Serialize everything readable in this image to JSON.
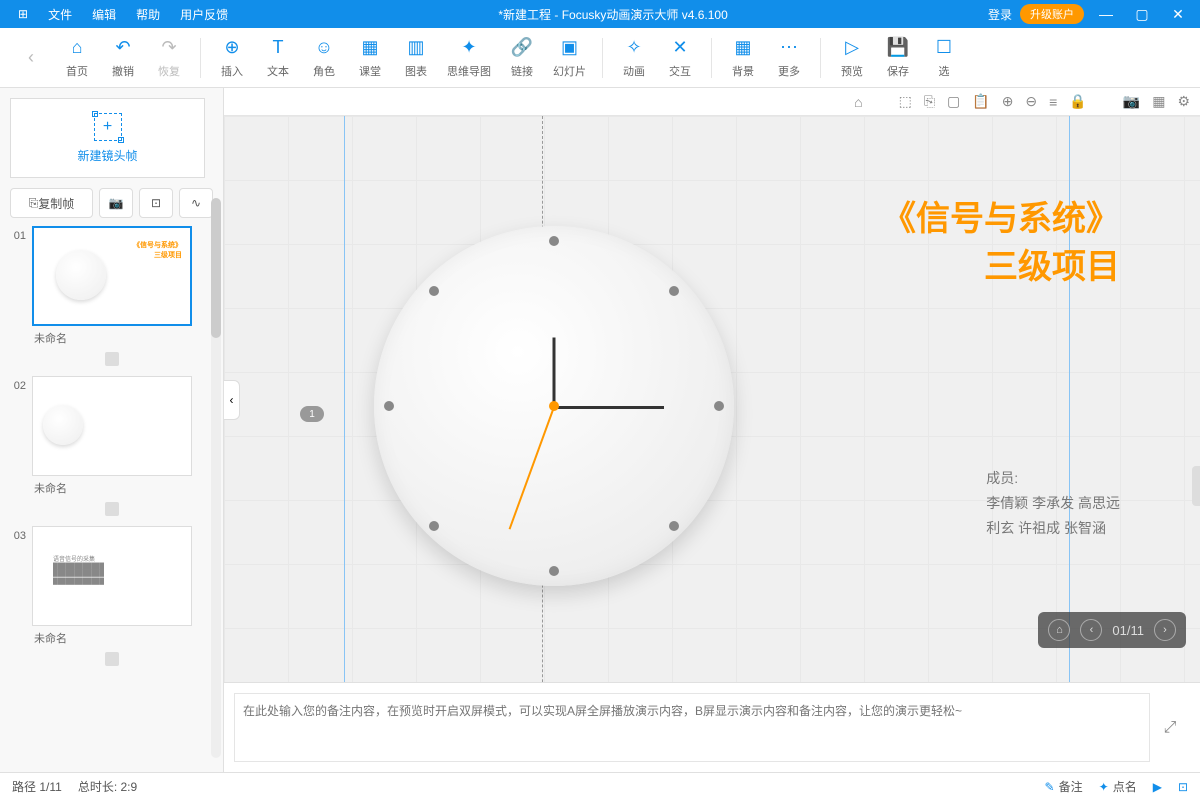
{
  "titlebar": {
    "title": "*新建工程 - Focusky动画演示大师  v4.6.100",
    "login": "登录",
    "upgrade": "升级账户",
    "menus": [
      "文件",
      "编辑",
      "帮助",
      "用户反馈"
    ]
  },
  "toolbar": {
    "home": "首页",
    "undo": "撤销",
    "redo": "恢复",
    "insert": "插入",
    "text": "文本",
    "role": "角色",
    "class": "课堂",
    "chart": "图表",
    "mind": "思维导图",
    "link": "链接",
    "slide": "幻灯片",
    "anim": "动画",
    "interact": "交互",
    "bg": "背景",
    "more": "更多",
    "preview": "预览",
    "save": "保存",
    "select": "选"
  },
  "sidebar": {
    "newframe": "新建镜头帧",
    "copy": "复制帧",
    "thumbs": [
      {
        "num": "01",
        "label": "未命名"
      },
      {
        "num": "02",
        "label": "未命名"
      },
      {
        "num": "03",
        "label": "未命名"
      }
    ]
  },
  "canvas": {
    "title1": "《信号与系统》",
    "title2": "三级项目",
    "members_label": "成员:",
    "members_l1": "李倩颖  李承发   高思远",
    "members_l2": "利玄     许祖成   张智涵",
    "marker": "1",
    "nav": "01/11"
  },
  "notes": {
    "placeholder": "在此处输入您的备注内容，在预览时开启双屏模式，可以实现A屏全屏播放演示内容，B屏显示演示内容和备注内容，让您的演示更轻松~"
  },
  "status": {
    "path": "路径 1/11",
    "duration": "总时长: 2:9",
    "note": "备注",
    "eye": "点名"
  }
}
